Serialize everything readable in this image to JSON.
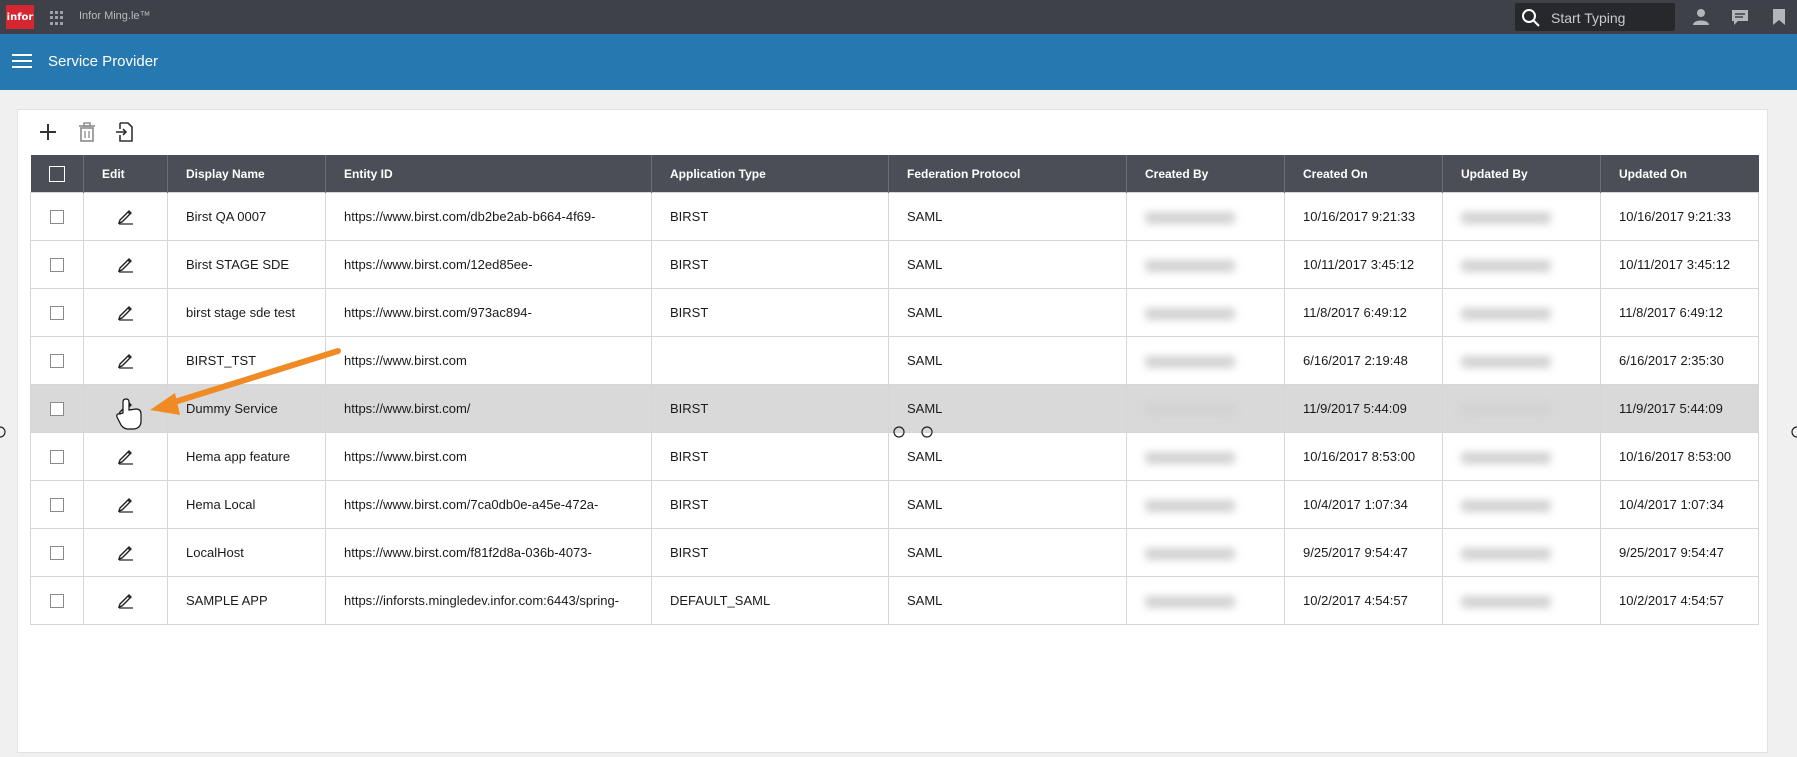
{
  "topbar": {
    "logo_text": "infor",
    "app_title": "Infor Ming.le™",
    "search_placeholder": "Start Typing",
    "icons": [
      "apps-grid-icon",
      "search-icon",
      "user-icon",
      "chat-icon",
      "bookmark-icon"
    ]
  },
  "header": {
    "title": "Service Provider",
    "bg_color": "#2578b0"
  },
  "toolbar": {
    "icons": [
      "add-icon",
      "delete-icon",
      "import-icon"
    ]
  },
  "table": {
    "columns": [
      "Edit",
      "Display Name",
      "Entity ID",
      "Application Type",
      "Federation Protocol",
      "Created By",
      "Created On",
      "Updated By",
      "Updated On"
    ],
    "rows": [
      {
        "display_name": "Birst QA 0007",
        "entity_id": "https://www.birst.com/db2be2ab-b664-4f69-",
        "app_type": "BIRST",
        "protocol": "SAML",
        "created_on": "10/16/2017 9:21:33",
        "updated_on": "10/16/2017 9:21:33"
      },
      {
        "display_name": "Birst STAGE SDE",
        "entity_id": "https://www.birst.com/12ed85ee-",
        "app_type": "BIRST",
        "protocol": "SAML",
        "created_on": "10/11/2017 3:45:12",
        "updated_on": "10/11/2017 3:45:12"
      },
      {
        "display_name": "birst stage sde test",
        "entity_id": "https://www.birst.com/973ac894-",
        "app_type": "BIRST",
        "protocol": "SAML",
        "created_on": "11/8/2017 6:49:12",
        "updated_on": "11/8/2017 6:49:12"
      },
      {
        "display_name": "BIRST_TST",
        "entity_id": "https://www.birst.com",
        "app_type": "",
        "protocol": "SAML",
        "created_on": "6/16/2017 2:19:48",
        "updated_on": "6/16/2017 2:35:30"
      },
      {
        "display_name": "Dummy Service",
        "entity_id": "https://www.birst.com/",
        "app_type": "BIRST",
        "protocol": "SAML",
        "created_on": "11/9/2017 5:44:09",
        "updated_on": "11/9/2017 5:44:09"
      },
      {
        "display_name": "Hema app feature",
        "entity_id": "https://www.birst.com",
        "app_type": "BIRST",
        "protocol": "SAML",
        "created_on": "10/16/2017 8:53:00",
        "updated_on": "10/16/2017 8:53:00"
      },
      {
        "display_name": "Hema Local",
        "entity_id": "https://www.birst.com/7ca0db0e-a45e-472a-",
        "app_type": "BIRST",
        "protocol": "SAML",
        "created_on": "10/4/2017 1:07:34",
        "updated_on": "10/4/2017 1:07:34"
      },
      {
        "display_name": "LocalHost",
        "entity_id": "https://www.birst.com/f81f2d8a-036b-4073-",
        "app_type": "BIRST",
        "protocol": "SAML",
        "created_on": "9/25/2017 9:54:47",
        "updated_on": "9/25/2017 9:54:47"
      },
      {
        "display_name": "SAMPLE APP",
        "entity_id": "https://inforsts.mingledev.infor.com:6443/spring-",
        "app_type": "DEFAULT_SAML",
        "protocol": "SAML",
        "created_on": "10/2/2017 4:54:57",
        "updated_on": "10/2/2017 4:54:57"
      }
    ],
    "selected_row": "Dummy Service"
  },
  "colors": {
    "topbar": "#3e4147",
    "header": "#2578b0",
    "table_header": "#4b4e56",
    "selected_row": "#d9d9d9",
    "annotation_arrow": "#f08a24",
    "logo": "#d62631"
  }
}
